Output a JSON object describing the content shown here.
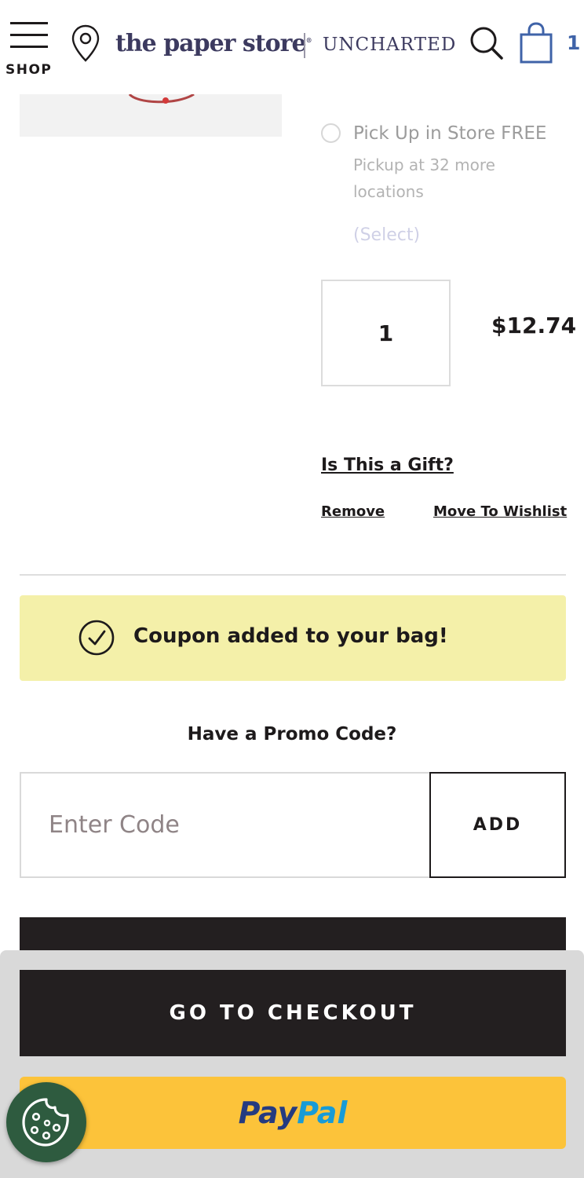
{
  "header": {
    "shop_label": "SHOP",
    "logo": "the paper store",
    "brand2": "UNCHARTED",
    "bag_count": "1"
  },
  "item": {
    "pickup_title": "Pick Up in Store FREE",
    "pickup_sub": "Pickup at 32 more locations",
    "select_label": "(Select)",
    "quantity": "1",
    "price": "$12.74",
    "gift_link": "Is This a Gift?",
    "remove_link": "Remove",
    "wishlist_link": "Move To Wishlist"
  },
  "coupon": {
    "message": "Coupon added to your bag!"
  },
  "promo": {
    "title": "Have a Promo Code?",
    "placeholder": "Enter Code",
    "add_label": "ADD"
  },
  "footer": {
    "checkout_label": "GO TO CHECKOUT",
    "paypal_pay": "Pay",
    "paypal_pal": "Pal"
  },
  "colors": {
    "brand_navy": "#3c3a5f",
    "bag_blue": "#3f63a8",
    "coupon_bg": "#f4f0a9",
    "checkout_bg": "#231f20",
    "paypal_bg": "#fcc33a",
    "cookie_bg": "#2e5b3f"
  }
}
